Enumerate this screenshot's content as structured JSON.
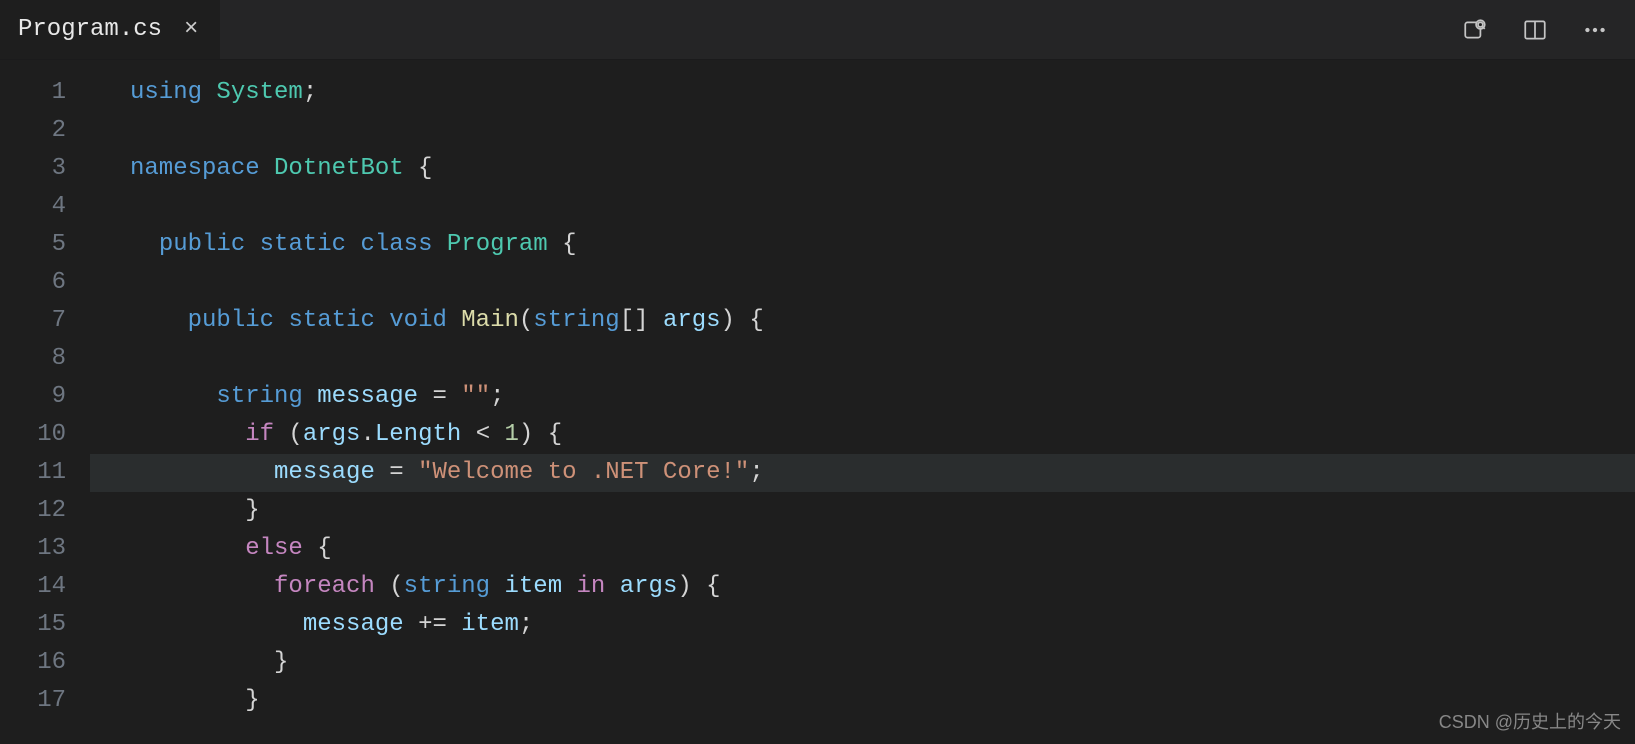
{
  "tab": {
    "filename": "Program.cs",
    "close_glyph": "×"
  },
  "actions": {
    "open_changes_label": "open-changes",
    "split_label": "split-editor",
    "more_label": "more-actions"
  },
  "gutter": {
    "line_numbers": [
      "1",
      "2",
      "3",
      "4",
      "5",
      "6",
      "7",
      "8",
      "9",
      "10",
      "11",
      "12",
      "13",
      "14",
      "15",
      "16",
      "17"
    ]
  },
  "code": {
    "highlight_line": 11,
    "tokens": [
      [
        [
          "kw",
          "using"
        ],
        [
          "pun",
          " "
        ],
        [
          "type",
          "System"
        ],
        [
          "pun",
          ";"
        ]
      ],
      [],
      [
        [
          "kw",
          "namespace"
        ],
        [
          "pun",
          " "
        ],
        [
          "type",
          "DotnetBot"
        ],
        [
          "pun",
          " {"
        ]
      ],
      [],
      [
        [
          "pun",
          "  "
        ],
        [
          "kw",
          "public"
        ],
        [
          "pun",
          " "
        ],
        [
          "kw",
          "static"
        ],
        [
          "pun",
          " "
        ],
        [
          "kw",
          "class"
        ],
        [
          "pun",
          " "
        ],
        [
          "type",
          "Program"
        ],
        [
          "pun",
          " {"
        ]
      ],
      [],
      [
        [
          "pun",
          "    "
        ],
        [
          "kw",
          "public"
        ],
        [
          "pun",
          " "
        ],
        [
          "kw",
          "static"
        ],
        [
          "pun",
          " "
        ],
        [
          "kw",
          "void"
        ],
        [
          "pun",
          " "
        ],
        [
          "func",
          "Main"
        ],
        [
          "pun",
          "("
        ],
        [
          "typekw",
          "string"
        ],
        [
          "pun",
          "[] "
        ],
        [
          "var",
          "args"
        ],
        [
          "pun",
          ") {"
        ]
      ],
      [],
      [
        [
          "pun",
          "      "
        ],
        [
          "typekw",
          "string"
        ],
        [
          "pun",
          " "
        ],
        [
          "var",
          "message"
        ],
        [
          "pun",
          " "
        ],
        [
          "op",
          "="
        ],
        [
          "pun",
          " "
        ],
        [
          "str",
          "\"\""
        ],
        [
          "pun",
          ";"
        ]
      ],
      [
        [
          "pun",
          "        "
        ],
        [
          "ctrl",
          "if"
        ],
        [
          "pun",
          " ("
        ],
        [
          "var",
          "args"
        ],
        [
          "pun",
          "."
        ],
        [
          "var",
          "Length"
        ],
        [
          "pun",
          " "
        ],
        [
          "op",
          "<"
        ],
        [
          "pun",
          " "
        ],
        [
          "num",
          "1"
        ],
        [
          "pun",
          ") {"
        ]
      ],
      [
        [
          "pun",
          "          "
        ],
        [
          "var",
          "message"
        ],
        [
          "pun",
          " "
        ],
        [
          "op",
          "="
        ],
        [
          "pun",
          " "
        ],
        [
          "str",
          "\"Welcome to .NET Core!\""
        ],
        [
          "pun",
          ";"
        ]
      ],
      [
        [
          "pun",
          "        }"
        ]
      ],
      [
        [
          "pun",
          "        "
        ],
        [
          "ctrl",
          "else"
        ],
        [
          "pun",
          " {"
        ]
      ],
      [
        [
          "pun",
          "          "
        ],
        [
          "ctrl",
          "foreach"
        ],
        [
          "pun",
          " ("
        ],
        [
          "typekw",
          "string"
        ],
        [
          "pun",
          " "
        ],
        [
          "var",
          "item"
        ],
        [
          "pun",
          " "
        ],
        [
          "ctrl",
          "in"
        ],
        [
          "pun",
          " "
        ],
        [
          "var",
          "args"
        ],
        [
          "pun",
          ") {"
        ]
      ],
      [
        [
          "pun",
          "            "
        ],
        [
          "var",
          "message"
        ],
        [
          "pun",
          " "
        ],
        [
          "op",
          "+="
        ],
        [
          "pun",
          " "
        ],
        [
          "var",
          "item"
        ],
        [
          "pun",
          ";"
        ]
      ],
      [
        [
          "pun",
          "          }"
        ]
      ],
      [
        [
          "pun",
          "        }"
        ]
      ]
    ]
  },
  "watermark": "CSDN @历史上的今天"
}
